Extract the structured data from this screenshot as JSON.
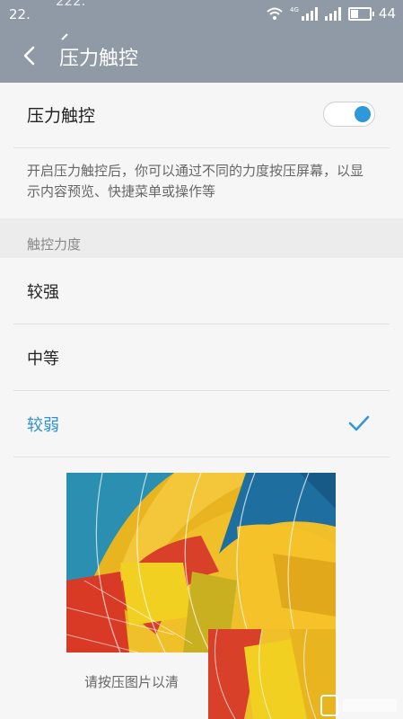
{
  "status_bar": {
    "time": "22.",
    "overlap_text": "222.",
    "network_tag": "4G",
    "battery": "44",
    "battery_level": 0.44,
    "icons": [
      "wifi-icon",
      "signal-4g-icon",
      "signal-icon",
      "battery-icon"
    ]
  },
  "header": {
    "title": "压力触控",
    "back_icon": "back-arrow-icon"
  },
  "pressure_touch": {
    "label": "压力触控",
    "enabled": true,
    "description": "开启压力触控后，你可以通过不同的力度按压屏幕，以显示内容预览、快捷菜单或操作等"
  },
  "strength": {
    "header": "触控力度",
    "options": [
      {
        "label": "较强",
        "selected": false
      },
      {
        "label": "中等",
        "selected": false
      },
      {
        "label": "较弱",
        "selected": true
      }
    ]
  },
  "preview": {
    "hint": "请按压图片以",
    "hint_cut": "清"
  },
  "colors": {
    "title_bar": "#8f9aa6",
    "accent": "#2f98d8",
    "background": "#f6f6f6"
  }
}
